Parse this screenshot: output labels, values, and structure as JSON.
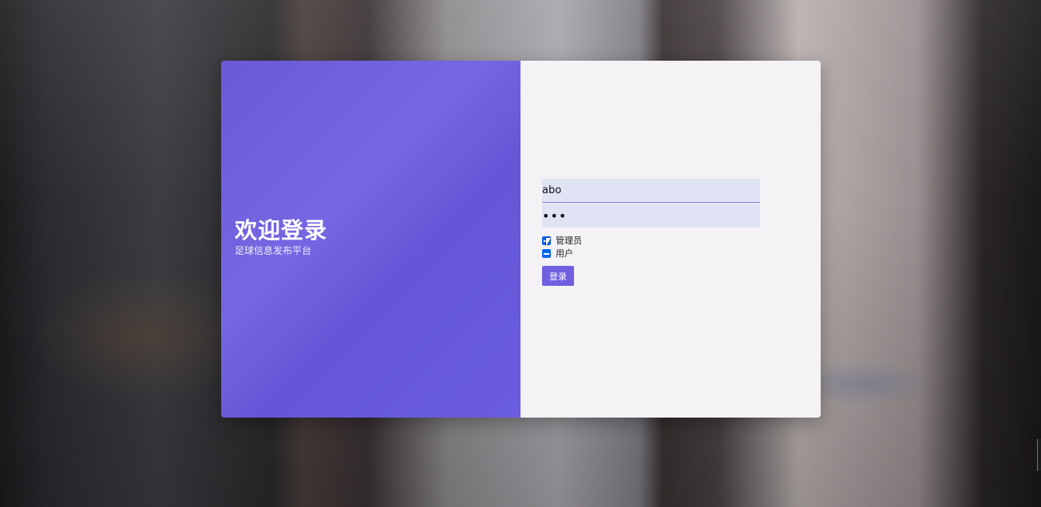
{
  "welcome": {
    "title": "欢迎登录",
    "subtitle": "足球信息发布平台"
  },
  "form": {
    "username_value": "abo",
    "password_value": "•••",
    "roles": [
      {
        "label": "管理员",
        "checked": true
      },
      {
        "label": "用户",
        "checked": true
      }
    ],
    "login_label": "登录"
  },
  "colors": {
    "accent": "#7060e0",
    "panel": "#6a59d8",
    "checkbox": "#0a68f0",
    "form_bg": "#f4f2f5"
  },
  "icons": {
    "cursor": "mouse-pointer-icon",
    "checkbox": "checkbox-checked-icon"
  }
}
